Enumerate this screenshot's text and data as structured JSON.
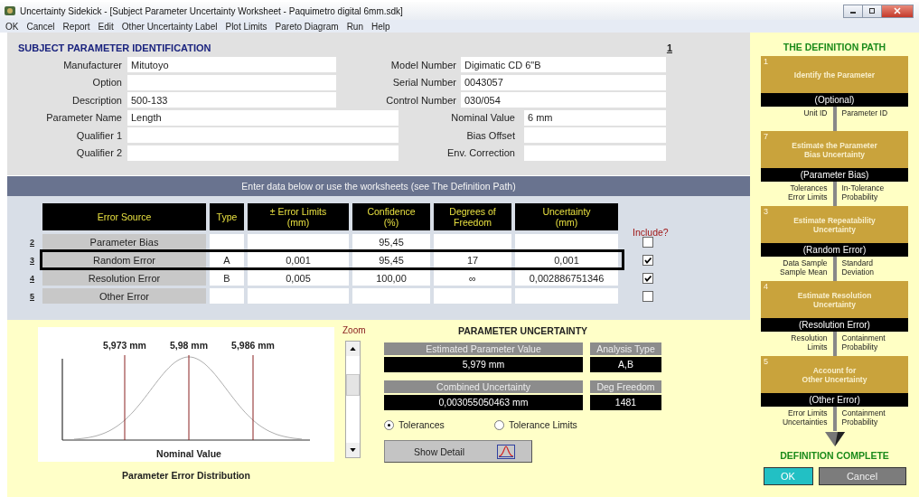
{
  "window": {
    "title": "Uncertainty Sidekick - [Subject Parameter Uncertainty Worksheet - Paquimetro digital 6mm.sdk]"
  },
  "menu": [
    "OK",
    "Cancel",
    "Report",
    "Edit",
    "Other Uncertainty Label",
    "Plot Limits",
    "Pareto Diagram",
    "Run",
    "Help"
  ],
  "identification": {
    "title": "SUBJECT PARAMETER IDENTIFICATION",
    "page": "1",
    "rows": [
      {
        "left": {
          "label": "Manufacturer",
          "value": "Mitutoyo"
        },
        "right": {
          "label": "Model Number",
          "value": "Digimatic CD 6\"B"
        }
      },
      {
        "left": {
          "label": "Option"
        },
        "right": {
          "label": "Serial Number",
          "value": "0043057"
        }
      },
      {
        "left": {
          "label": "Description",
          "value": "500-133"
        },
        "right": {
          "label": "Control Number",
          "value": "030/054"
        }
      },
      {
        "left": {
          "label": "Parameter Name",
          "value": "Length"
        },
        "right": {
          "label": "Nominal Value",
          "value": "6 mm"
        }
      },
      {
        "left": {
          "label": "Qualifier 1"
        },
        "right": {
          "label": "Bias Offset"
        }
      },
      {
        "left": {
          "label": "Qualifier 2"
        },
        "right": {
          "label": "Env. Correction"
        }
      }
    ]
  },
  "errors": {
    "banner": "Enter data below or use the worksheets (see The Definition Path)",
    "columns": [
      "Error Source",
      "Type",
      "± Error Limits\n(mm)",
      "Confidence\n(%)",
      "Degrees of\nFreedom",
      "Uncertainty\n(mm)"
    ],
    "include_header": "Include?",
    "rows": [
      {
        "num": "2",
        "source": "Parameter Bias",
        "confidence": "95,45",
        "include": false,
        "selected": false
      },
      {
        "num": "3",
        "source": "Random Error",
        "type": "A",
        "limits": "0,001",
        "confidence": "95,45",
        "dof": "17",
        "uncertainty": "0,001",
        "include": true,
        "selected": true
      },
      {
        "num": "4",
        "source": "Resolution Error",
        "type": "B",
        "limits": "0,005",
        "confidence": "100,00",
        "dof": "∞",
        "uncertainty": "0,002886751346",
        "include": true,
        "selected": false
      },
      {
        "num": "5",
        "source": "Other Error",
        "include": false,
        "selected": false
      }
    ]
  },
  "distribution": {
    "markers": [
      "5,973 mm",
      "5,98 mm",
      "5,986 mm"
    ],
    "xlabel": "Nominal Value",
    "caption": "Parameter Error Distribution",
    "zoom_label": "Zoom"
  },
  "results": {
    "title": "PARAMETER UNCERTAINTY",
    "boxes": [
      {
        "label": "Estimated Parameter Value",
        "value": "5,979 mm"
      },
      {
        "label": "Analysis Type",
        "value": "A,B"
      },
      {
        "label": "Combined Uncertainty",
        "value": "0,003055050463 mm"
      },
      {
        "label": "Deg Freedom",
        "value": "1481"
      }
    ],
    "options": [
      {
        "label": "Tolerances",
        "selected": true
      },
      {
        "label": "Tolerance Limits",
        "selected": false
      }
    ],
    "detail_button": "Show Detail"
  },
  "definition_path": {
    "title": "THE DEFINITION PATH",
    "steps": [
      {
        "number": "1",
        "title": "Identify the Parameter",
        "subtitle": "(Optional)",
        "left": "Unit ID",
        "right": "Parameter ID"
      },
      {
        "number": "7",
        "title": "Estimate the Parameter\nBias Uncertainty",
        "subtitle": "(Parameter Bias)",
        "left": "Tolerances\nError Limits",
        "right": "In-Tolerance\nProbability"
      },
      {
        "number": "3",
        "title": "Estimate Repeatability\nUncertainty",
        "subtitle": "(Random Error)",
        "left": "Data Sample\nSample Mean",
        "right": "Standard\nDeviation"
      },
      {
        "number": "4",
        "title": "Estimate Resolution\nUncertainty",
        "subtitle": "(Resolution Error)",
        "left": "Resolution\nLimits",
        "right": "Containment\nProbability"
      },
      {
        "number": "5",
        "title": "Account for\nOther Uncertainty",
        "subtitle": "(Other Error)",
        "left": "Error Limits\nUncertainties",
        "right": "Containment\nProbability"
      }
    ],
    "complete": "DEFINITION COMPLETE",
    "buttons": [
      {
        "label": "OK",
        "kind": "primary"
      },
      {
        "label": "Cancel",
        "kind": "secondary"
      }
    ]
  }
}
